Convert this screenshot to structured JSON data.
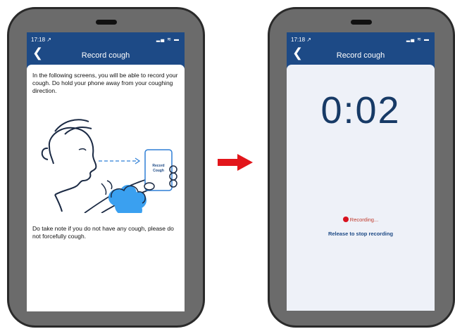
{
  "colors": {
    "nav": "#1d4a86",
    "arrow": "#e2161b",
    "phone_body": "#6b6b6b",
    "timer": "#173a66"
  },
  "left_screen": {
    "status": {
      "time": "17:18 ↗",
      "icons": "▂▄ ≋ ▬"
    },
    "nav": {
      "back_icon": "back-chevron-icon",
      "title": "Record cough"
    },
    "intro": "In the following screens, you will be able to record your cough. Do hold your phone away from your coughing direction.",
    "illustration": {
      "card_label_line1": "Record",
      "card_label_line2": "Cough"
    },
    "note": "Do take note if you do not have any cough, please do not forcefully cough."
  },
  "transition": {
    "icon": "right-arrow-icon"
  },
  "right_screen": {
    "status": {
      "time": "17:18 ↗",
      "icons": "▂▄ ≋ ▬"
    },
    "nav": {
      "back_icon": "back-chevron-icon",
      "title": "Record cough"
    },
    "timer": "0:02",
    "recording_status": "Recording...",
    "instruction": "Release to stop recording"
  }
}
